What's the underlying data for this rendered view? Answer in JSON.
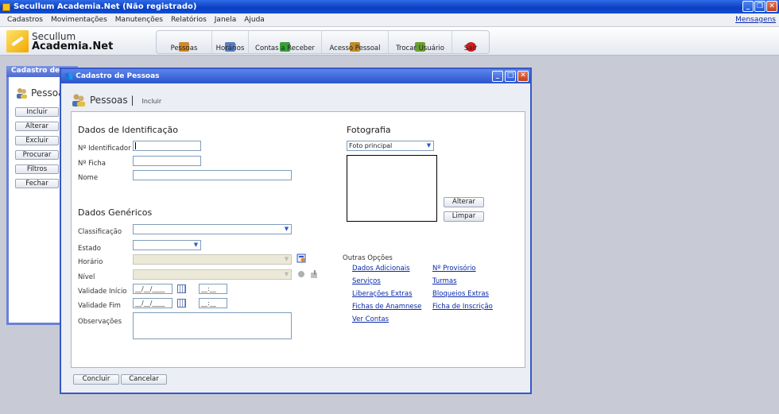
{
  "app": {
    "title": "Secullum Academia.Net (Não registrado)"
  },
  "menu": {
    "items": [
      "Cadastros",
      "Movimentações",
      "Manutenções",
      "Relatórios",
      "Janela",
      "Ajuda"
    ],
    "messages": "Mensagens"
  },
  "logo": {
    "line1": "Secullum",
    "line2": "Academia.Net"
  },
  "toolbar": {
    "buttons": [
      {
        "label": "Pessoas",
        "icon": "people-icon",
        "color": "#d08a2a"
      },
      {
        "label": "Horários",
        "icon": "schedule-icon",
        "color": "#5a7fc0"
      },
      {
        "label": "Contas a Receber",
        "icon": "add-money-icon",
        "color": "#3aa03a"
      },
      {
        "label": "Acesso Pessoal",
        "icon": "person-access-icon",
        "color": "#c08a2a"
      },
      {
        "label": "Trocar Usuário",
        "icon": "switch-user-icon",
        "color": "#6aa030"
      },
      {
        "label": "Sair",
        "icon": "power-icon",
        "color": "#d02020"
      }
    ]
  },
  "bg_window": {
    "title": "Cadastro de",
    "header": "Pessoa",
    "buttons": [
      "Incluir",
      "Alterar",
      "Excluir",
      "Procurar",
      "Filtros",
      "Fechar"
    ]
  },
  "dialog": {
    "title": "Cadastro de Pessoas",
    "header": "Pessoas |",
    "mode": "Incluir",
    "identificacao": {
      "title": "Dados de Identificação",
      "id_label": "Nº Identificador",
      "ficha_label": "Nº Ficha",
      "nome_label": "Nome"
    },
    "genericos": {
      "title": "Dados Genéricos",
      "classificacao": "Classificação",
      "estado": "Estado",
      "horario": "Horário",
      "nivel": "Nível",
      "validade_inicio": "Validade Início",
      "validade_fim": "Validade Fim",
      "observacoes": "Observações",
      "date_mask": "__/__/____",
      "time_mask": "__:__"
    },
    "fotografia": {
      "title": "Fotografia",
      "select_value": "Foto principal",
      "alterar": "Alterar",
      "limpar": "Limpar"
    },
    "outras": {
      "title": "Outras Opções",
      "col1": [
        "Dados Adicionais",
        "Serviços",
        "Liberações Extras",
        "Fichas de Anamnese",
        "Ver Contas"
      ],
      "col2": [
        "Nº Provisório",
        "Turmas",
        "Bloqueios Extras",
        "Ficha de Inscrição"
      ]
    },
    "concluir": "Concluir",
    "cancelar": "Cancelar"
  }
}
